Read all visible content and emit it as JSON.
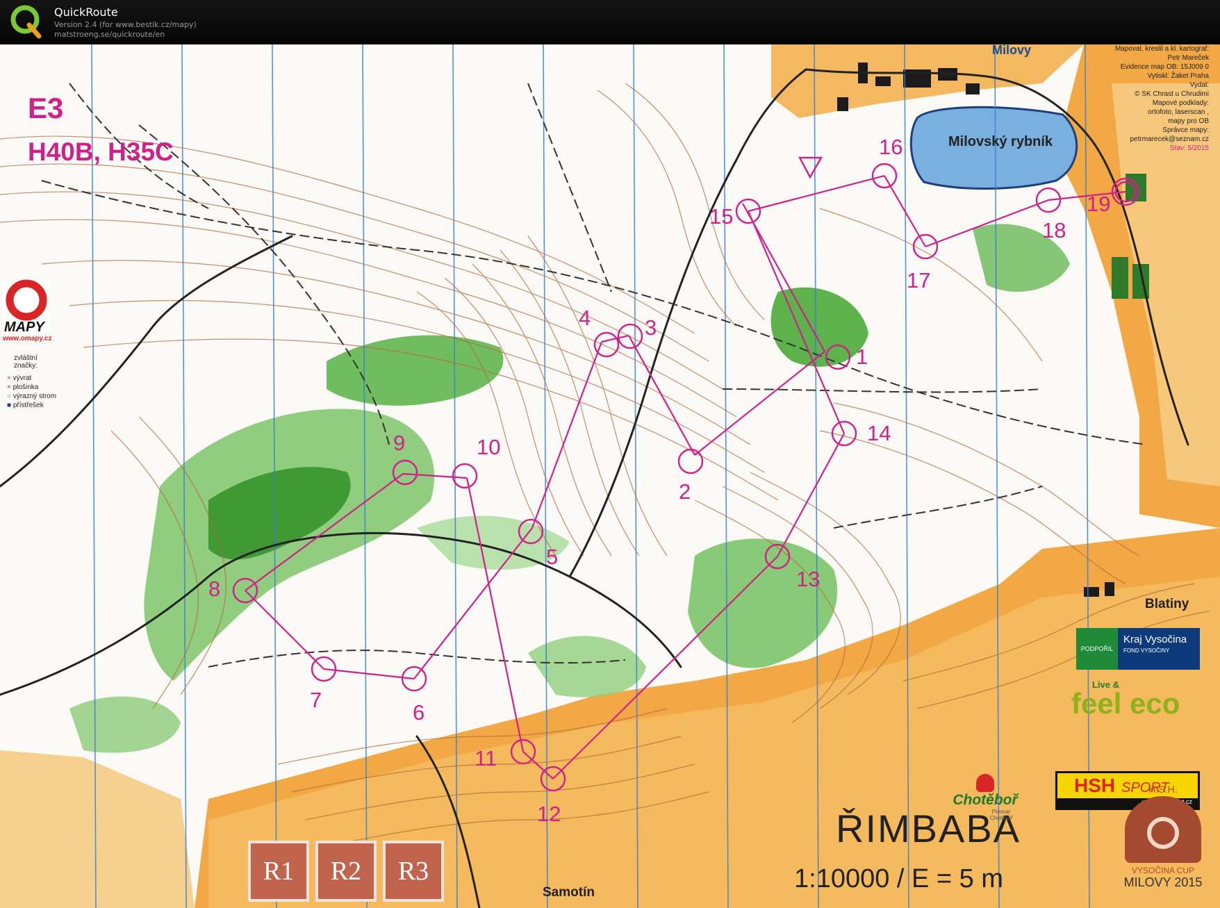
{
  "app": {
    "title": "QuickRoute",
    "version_line": "Version 2.4  (for www.bestik.cz/mapy)",
    "url_line": "matstroeng.se/quickroute/en",
    "logo_letter": "Q"
  },
  "map": {
    "course_code": "E3",
    "categories": "H40B, H35C",
    "event_name": "ŘIMBABA",
    "scale_line": "1:10000 / E = 5 m",
    "places": {
      "village_top": "Milovy",
      "lake": "Milovský rybník",
      "village_right": "Blatiny",
      "village_bottom": "Samotín"
    },
    "credits": [
      "Mapoval, kreslil a kl. kartograf:",
      "Petr Mareček",
      "Evidence map OB: 15J009 0",
      "Vytiskl: Žaket Praha",
      "Vydal:",
      "© SK Chrast u Chrudimi",
      "Mapové podklady:",
      "ortofoto, laserscan ,",
      "mapy pro OB",
      "Správce mapy:",
      "petrmarecek@seznam.cz",
      "Stav: 5/2015"
    ],
    "legend": {
      "brand": "MAPY",
      "url": "www.omapy.cz",
      "heading": "zvláštní značky:",
      "items": [
        "vývrat",
        "plošinka",
        "výrazný strom",
        "přístřešek"
      ]
    },
    "relay_boxes": [
      "R1",
      "R2",
      "R3"
    ],
    "controls": [
      "1",
      "2",
      "3",
      "4",
      "5",
      "6",
      "7",
      "8",
      "9",
      "10",
      "11",
      "12",
      "13",
      "14",
      "15",
      "16",
      "17",
      "18",
      "19"
    ],
    "sponsors": {
      "vysocina_left": "PODPOŘIL",
      "vysocina_main": "Kraj Vysočina",
      "vysocina_sub": "FOND VYSOČINY",
      "feel_eco_top": "Live &",
      "feel_eco": "feel eco",
      "hsh": "HSH",
      "hsh_script": "SPORT",
      "hsh_url": "www.HSHsport.cz",
      "chotebor": "Chotěboř",
      "chotebor_sub": "Pivovar Chotěboř",
      "cup_top": "H.S.H.",
      "cup_name": "VYSOČINA CUP",
      "cup_place": "MILOVY 2015"
    }
  },
  "colors": {
    "course": "#d0208a",
    "forest": "#4fa53a",
    "open_land": "#f0a640",
    "water": "#7ab0dd",
    "contour": "#b5673a",
    "magnetic_north": "#3a7fd0"
  }
}
